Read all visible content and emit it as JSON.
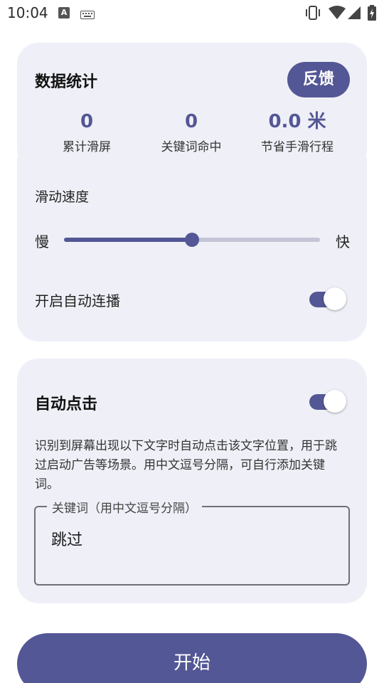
{
  "status_bar": {
    "time": "10:04",
    "notif_icon_letter": "A"
  },
  "stats_card": {
    "title": "数据统计",
    "feedback_label": "反馈",
    "stats": [
      {
        "value": "0",
        "label": "累计滑屏"
      },
      {
        "value": "0",
        "label": "关键词命中"
      },
      {
        "value": "0.0 米",
        "label": "节省手滑行程"
      }
    ]
  },
  "speed_card": {
    "title": "滑动速度",
    "slow_label": "慢",
    "fast_label": "快",
    "speed_level": 0.5,
    "autoplay_label": "开启自动连播",
    "autoplay_on": true
  },
  "auto_click_card": {
    "title": "自动点击",
    "enabled": true,
    "description": "识别到屏幕出现以下文字时自动点击该文字位置，用于跳过启动广告等场景。用中文逗号分隔，可自行添加关键词。",
    "keyword_field_label": "关键词（用中文逗号分隔）",
    "keyword_value": "跳过"
  },
  "start_button": {
    "label": "开始"
  },
  "colors": {
    "accent": "#545795",
    "card_bg": "#eff0f7",
    "track_inactive": "#c4c5d6"
  }
}
